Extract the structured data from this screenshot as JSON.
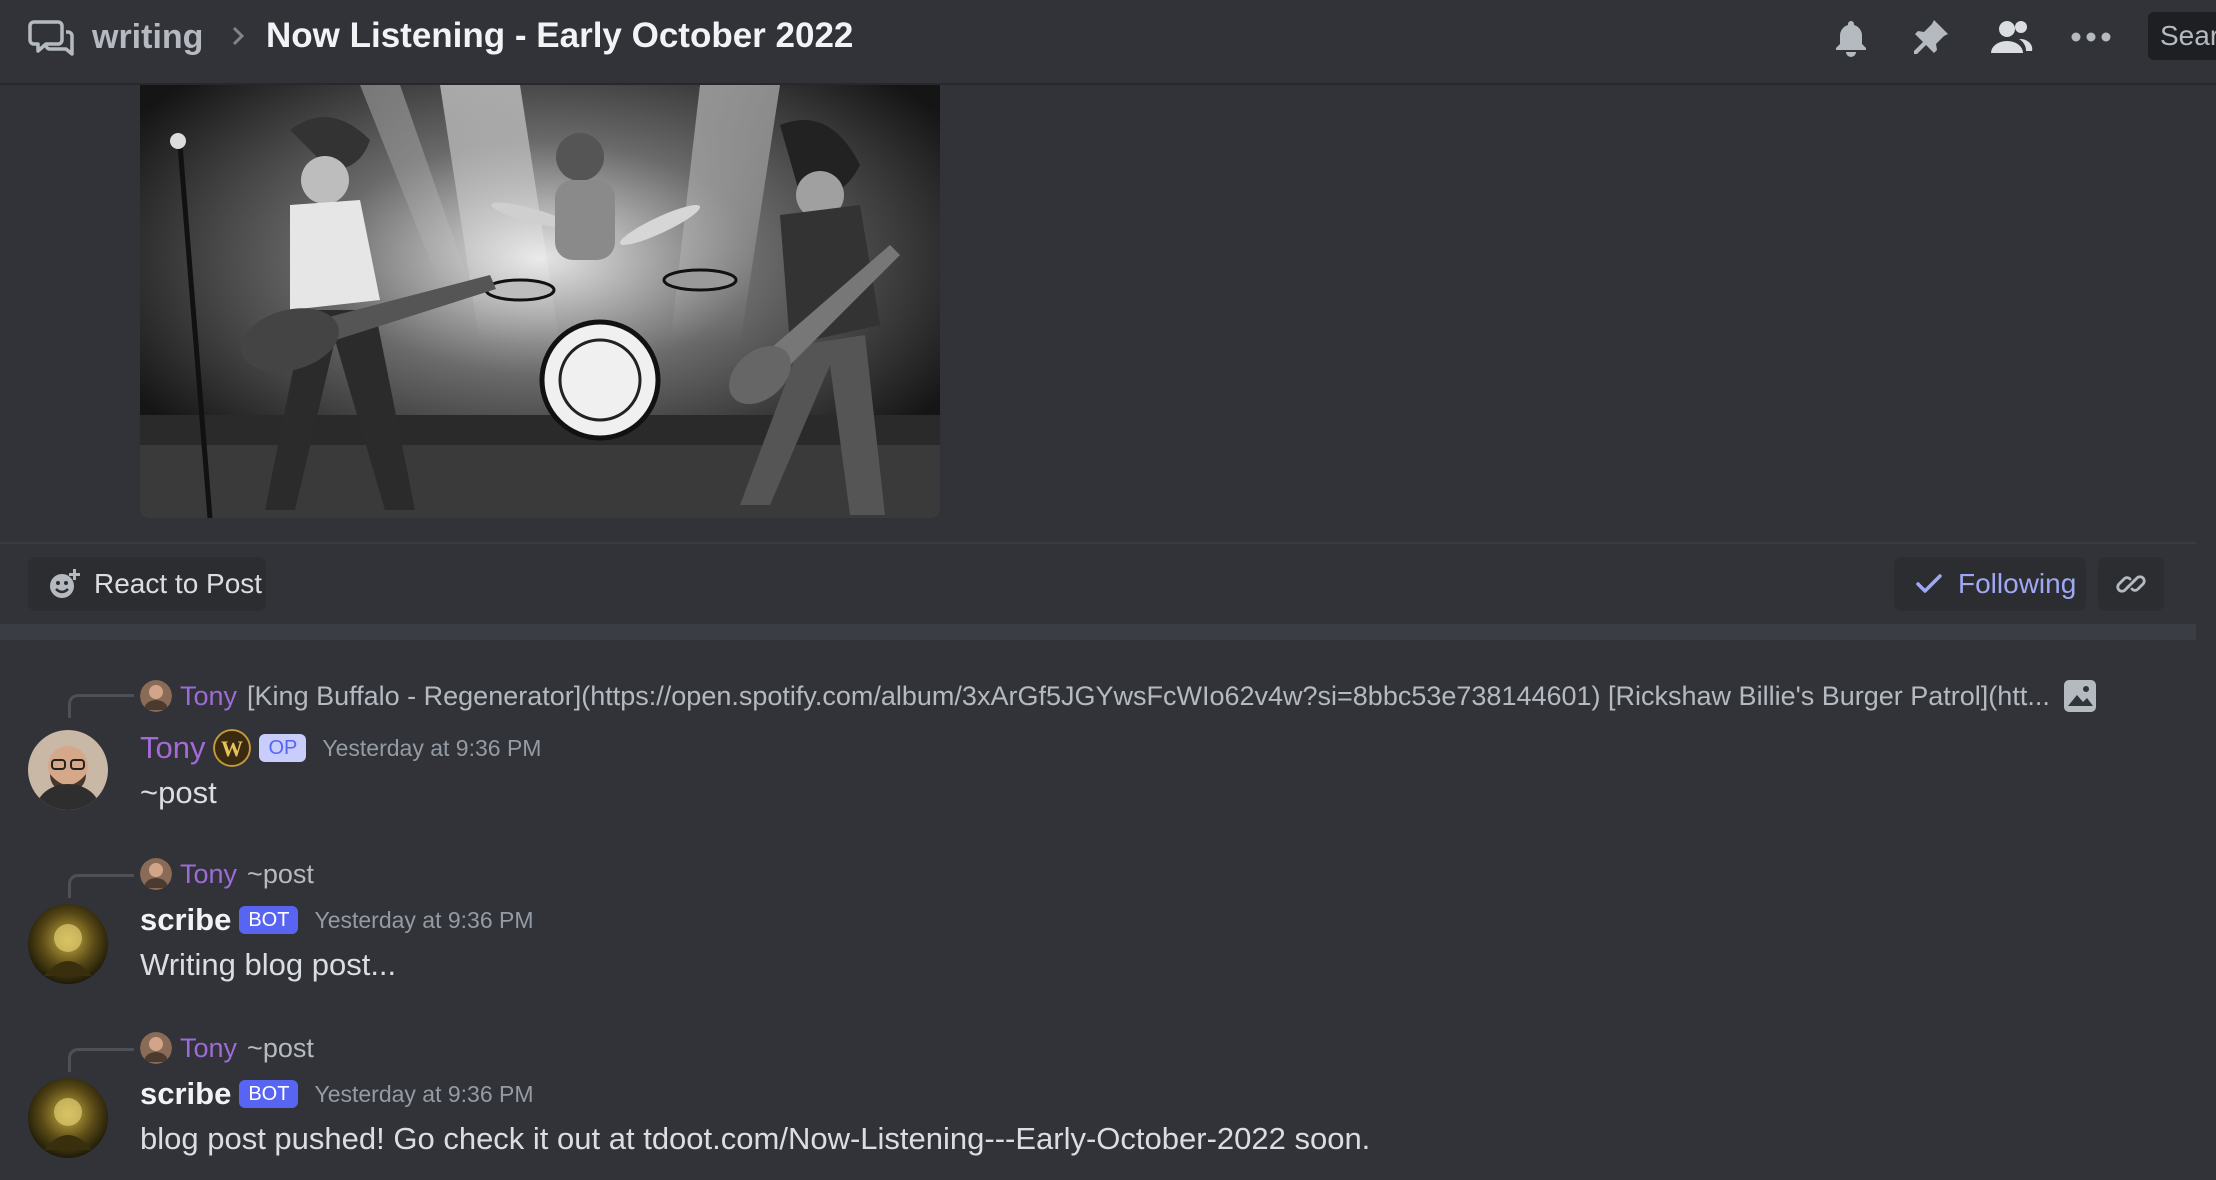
{
  "header": {
    "channel": "writing",
    "title": "Now Listening - Early October 2022",
    "search_placeholder": "Search"
  },
  "actions": {
    "react_label": "React to Post",
    "following_label": "Following"
  },
  "messages": [
    {
      "reply_author": "Tony",
      "reply_text": "[King Buffalo - Regenerator](https://open.spotify.com/album/3xArGf5JGYwsFcWIo62v4w?si=8bbc53e738144601)  [Rickshaw Billie's Burger Patrol](htt...",
      "author": "Tony",
      "tag": "OP",
      "timestamp": "Yesterday at 9:36 PM",
      "content": "~post"
    },
    {
      "reply_author": "Tony",
      "reply_text": "~post",
      "author": "scribe",
      "tag": "BOT",
      "timestamp": "Yesterday at 9:36 PM",
      "content": "Writing blog post..."
    },
    {
      "reply_author": "Tony",
      "reply_text": "~post",
      "author": "scribe",
      "tag": "BOT",
      "timestamp": "Yesterday at 9:36 PM",
      "content": "blog post pushed! Go check it out at tdoot.com/Now-Listening---Early-October-2022 soon."
    }
  ],
  "icons": {
    "header": [
      "threads-icon",
      "chevron-right-icon",
      "bell-icon",
      "pin-icon",
      "members-icon",
      "more-icon"
    ],
    "actions": [
      "add-reaction-icon",
      "check-icon",
      "link-icon"
    ],
    "reply": "image-icon"
  },
  "colors": {
    "background": "#313338",
    "accent": "#5865f2",
    "op_name": "#a46ad8",
    "following": "#a0a8f5"
  }
}
